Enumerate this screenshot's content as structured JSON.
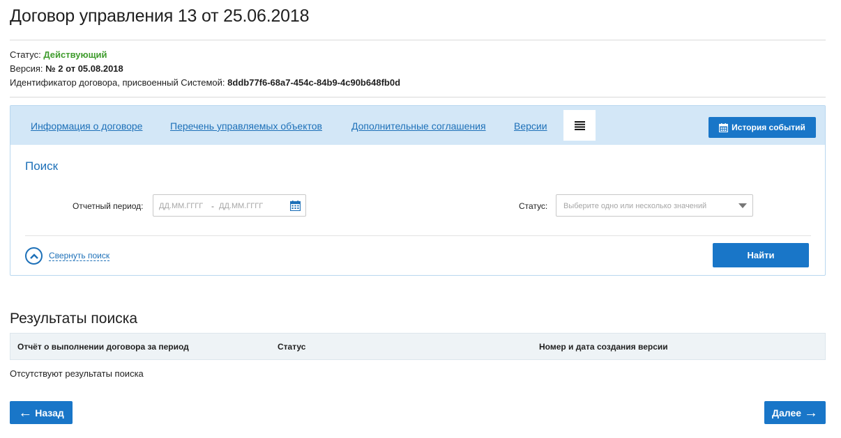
{
  "page": {
    "title": "Договор управления 13  от 25.06.2018"
  },
  "meta": {
    "status_label": "Статус: ",
    "status_value": "Действующий",
    "version_label": "Версия: ",
    "version_value": "№ 2 от 05.08.2018",
    "id_label": "Идентификатор договора, присвоенный Системой: ",
    "id_value": "8ddb77f6-68a7-454c-84b9-4c90b648fb0d"
  },
  "tabs": [
    {
      "label": "Информация о договоре"
    },
    {
      "label": "Перечень управляемых объектов"
    },
    {
      "label": "Дополнительные соглашения"
    },
    {
      "label": "Версии"
    }
  ],
  "active_tab_icon": "list-icon",
  "history_button": {
    "label": "История событий",
    "icon": "calendar-icon"
  },
  "search": {
    "title": "Поиск",
    "period_label": "Отчетный период:",
    "date_from_placeholder": "ДД.ММ.ГГГГ",
    "date_to_placeholder": "ДД.ММ.ГГГГ",
    "date_separator": "-",
    "status_label": "Статус:",
    "status_placeholder": "Выберите одно или несколько значений",
    "collapse_label": "Свернуть поиск",
    "find_button": "Найти"
  },
  "results": {
    "title": "Результаты поиска",
    "columns": [
      "Отчёт о выполнении договора за период",
      "Статус",
      "Номер и дата создания версии"
    ],
    "empty_text": "Отсутствуют результаты поиска"
  },
  "nav": {
    "back_label": "Назад",
    "back_arrow": "←",
    "next_label": "Далее",
    "next_arrow": "→"
  },
  "colors": {
    "accent": "#1976c8",
    "link": "#1d70b8",
    "status_active": "#3f9c2d",
    "tabbar_bg": "#d3e7f7"
  }
}
